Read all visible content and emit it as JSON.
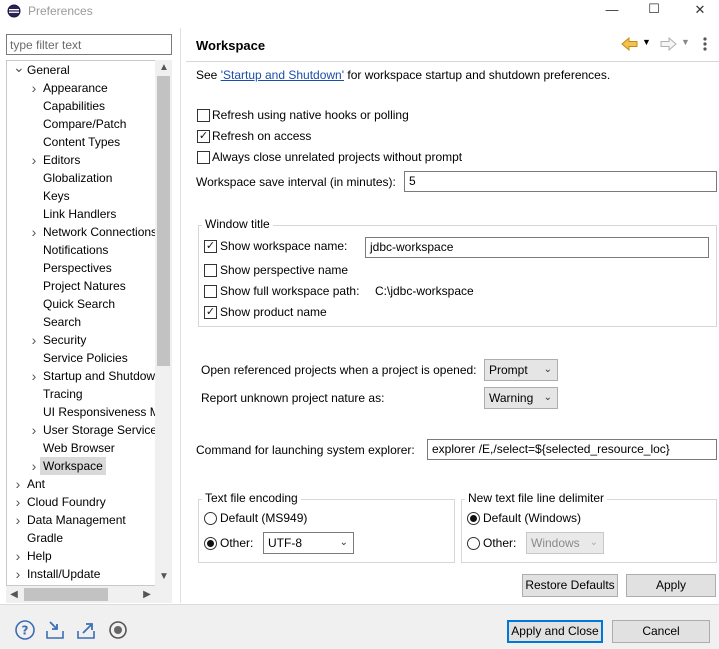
{
  "window": {
    "title": "Preferences",
    "minimize": "—",
    "maximize": "☐",
    "close": "✕"
  },
  "filter": {
    "placeholder": "type filter text"
  },
  "tree": {
    "general": "General",
    "children": [
      {
        "label": "Appearance",
        "expandable": true
      },
      {
        "label": "Capabilities",
        "expandable": false
      },
      {
        "label": "Compare/Patch",
        "expandable": false
      },
      {
        "label": "Content Types",
        "expandable": false
      },
      {
        "label": "Editors",
        "expandable": true
      },
      {
        "label": "Globalization",
        "expandable": false
      },
      {
        "label": "Keys",
        "expandable": false
      },
      {
        "label": "Link Handlers",
        "expandable": false
      },
      {
        "label": "Network Connections",
        "expandable": true
      },
      {
        "label": "Notifications",
        "expandable": false
      },
      {
        "label": "Perspectives",
        "expandable": false
      },
      {
        "label": "Project Natures",
        "expandable": false
      },
      {
        "label": "Quick Search",
        "expandable": false
      },
      {
        "label": "Search",
        "expandable": false
      },
      {
        "label": "Security",
        "expandable": true
      },
      {
        "label": "Service Policies",
        "expandable": false
      },
      {
        "label": "Startup and Shutdown",
        "expandable": true
      },
      {
        "label": "Tracing",
        "expandable": false
      },
      {
        "label": "UI Responsiveness Monitoring",
        "expandable": false
      },
      {
        "label": "User Storage Service",
        "expandable": true
      },
      {
        "label": "Web Browser",
        "expandable": false
      },
      {
        "label": "Workspace",
        "expandable": true,
        "selected": true
      }
    ],
    "top": [
      {
        "label": "Ant",
        "expandable": true
      },
      {
        "label": "Cloud Foundry",
        "expandable": true
      },
      {
        "label": "Data Management",
        "expandable": true
      },
      {
        "label": "Gradle",
        "expandable": false
      },
      {
        "label": "Help",
        "expandable": true
      },
      {
        "label": "Install/Update",
        "expandable": true
      }
    ]
  },
  "page": {
    "title": "Workspace",
    "see_prefix": "See ",
    "see_link": "'Startup and Shutdown'",
    "see_suffix": " for workspace startup and shutdown preferences.",
    "refresh_native": {
      "label": "Refresh using native hooks or polling",
      "checked": false
    },
    "refresh_access": {
      "label": "Refresh on access",
      "checked": true
    },
    "always_close": {
      "label": "Always close unrelated projects without prompt",
      "checked": false
    },
    "save_interval_label": "Workspace save interval (in minutes):",
    "save_interval_value": "5",
    "window_title": {
      "group_label": "Window title",
      "show_ws_name": {
        "label": "Show workspace name:",
        "checked": true
      },
      "ws_name_value": "jdbc-workspace",
      "show_perspective": {
        "label": "Show perspective name",
        "checked": false
      },
      "show_full_path": {
        "label": "Show full workspace path:",
        "checked": false
      },
      "full_path_value": "C:\\jdbc-workspace",
      "show_product": {
        "label": "Show product name",
        "checked": true
      }
    },
    "open_ref_label": "Open referenced projects when a project is opened:",
    "open_ref_value": "Prompt",
    "report_label": "Report unknown project nature as:",
    "report_value": "Warning",
    "command_label": "Command for launching system explorer:",
    "command_value": "explorer /E,/select=${selected_resource_loc}",
    "encoding": {
      "group_label": "Text file encoding",
      "default_label": "Default (MS949)",
      "other_label": "Other:",
      "other_value": "UTF-8",
      "selected": "other"
    },
    "delimiter": {
      "group_label": "New text file line delimiter",
      "default_label": "Default (Windows)",
      "other_label": "Other:",
      "other_value": "Windows",
      "selected": "default"
    },
    "restore_defaults": "Restore Defaults",
    "apply": "Apply"
  },
  "footer": {
    "apply_close": "Apply and Close",
    "cancel": "Cancel"
  },
  "colors": {
    "accent": "#0078d7",
    "link": "#1a4ea8",
    "back_arrow": "#e8a317"
  }
}
